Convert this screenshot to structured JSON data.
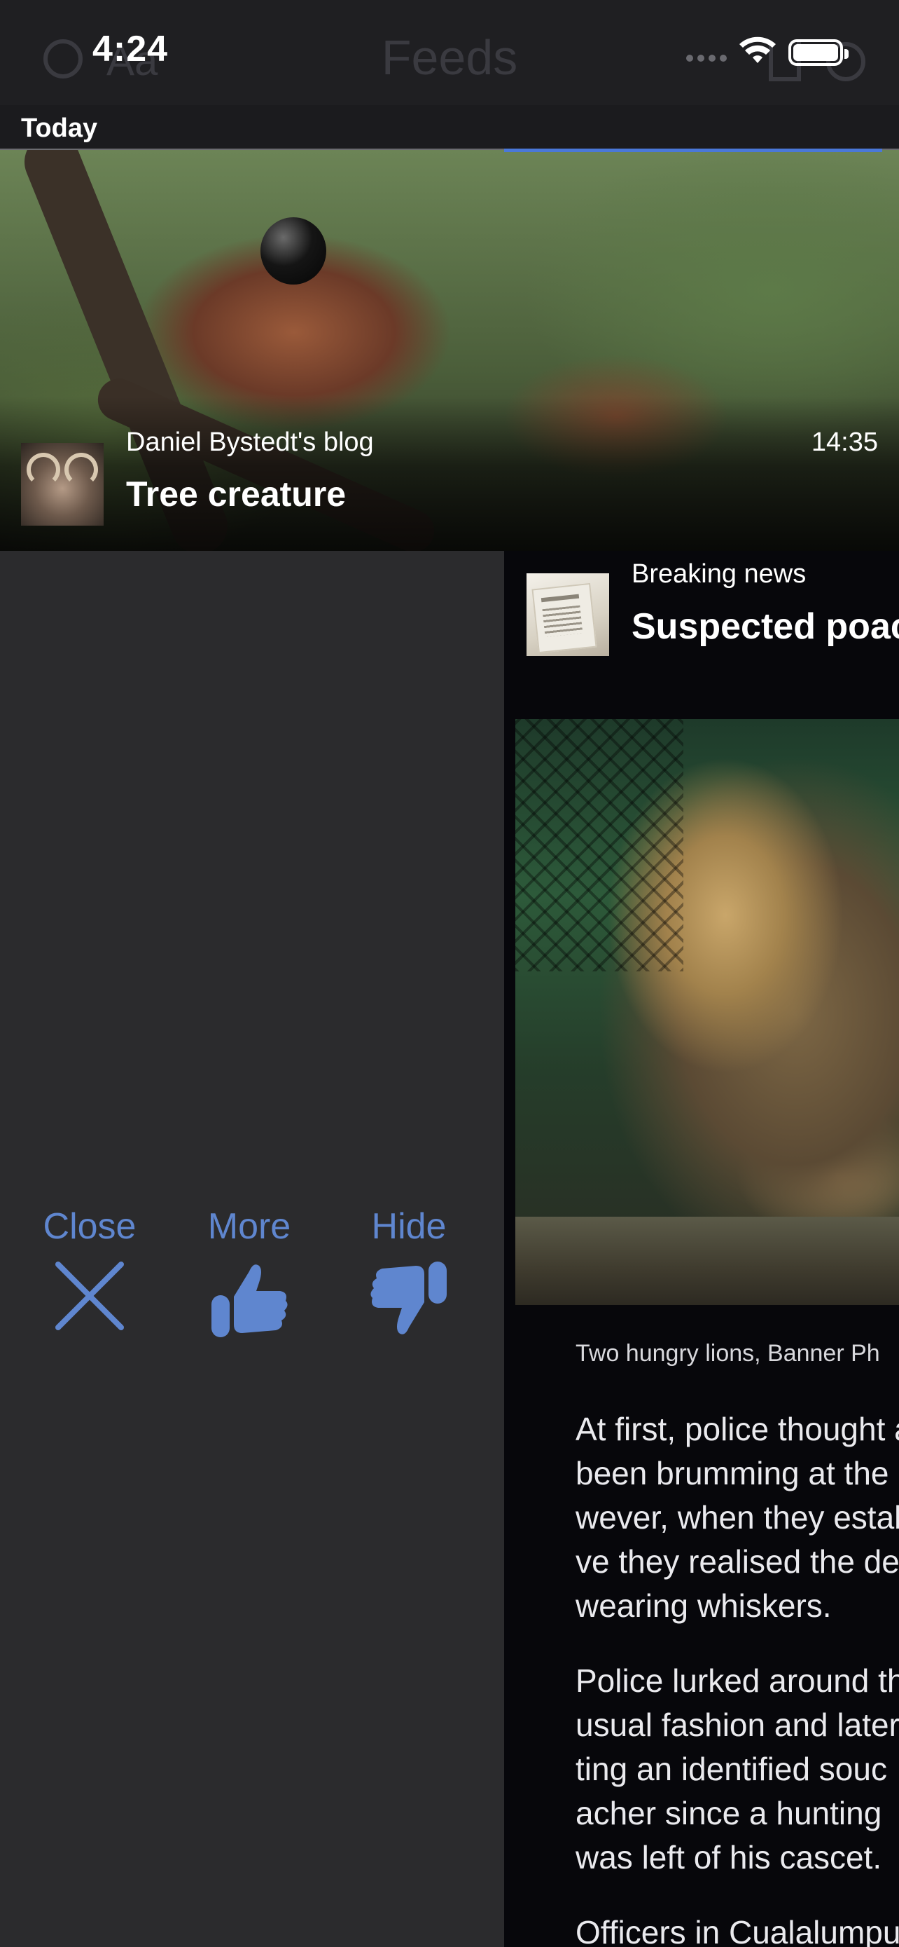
{
  "status_bar": {
    "time": "4:24"
  },
  "nav": {
    "title": "Feeds",
    "text_size_label": "Aa"
  },
  "section": {
    "label": "Today"
  },
  "top_article": {
    "source": "Daniel Bystedt's blog",
    "time": "14:35",
    "title": "Tree creature"
  },
  "actions": {
    "close_label": "Close",
    "more_label": "More",
    "hide_label": "Hide"
  },
  "article": {
    "source": "Breaking news",
    "title": "Suspected poac",
    "caption": "Two hungry lions, Banner Ph",
    "paragraphs": [
      [
        "At first, police thought a",
        "been brumming at the",
        "wever, when they estab",
        "ve they realised the de",
        "wearing whiskers."
      ],
      [
        "Police lurked around th",
        "usual fashion and later",
        "ting an identified souc",
        "acher since a hunting",
        "was left of his cascet."
      ],
      [
        "Officers in Cualalumpu"
      ]
    ]
  },
  "colors": {
    "accent": "#5f86cf",
    "progress": "#4a78d8"
  }
}
